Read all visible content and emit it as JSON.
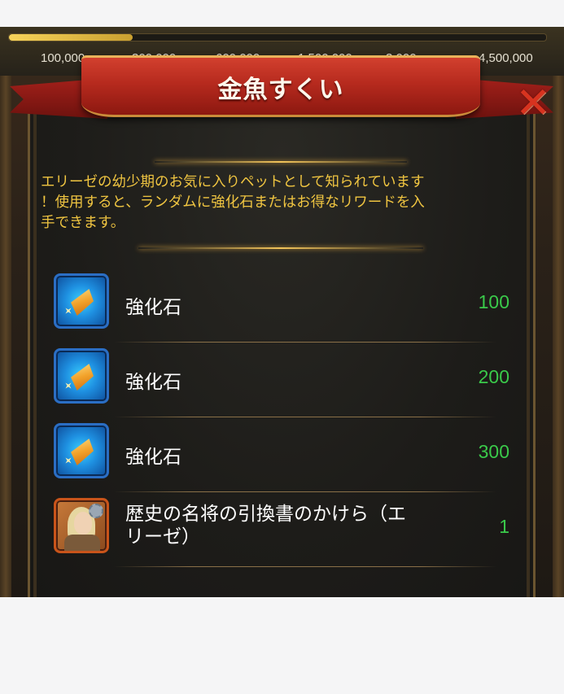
{
  "background": {
    "milestones": [
      "100,000",
      "300,000",
      "600,000",
      "1,500,000",
      "3,000",
      "4,500,000"
    ],
    "progress_fraction": 0.23
  },
  "dialog": {
    "title": "金魚すくい",
    "close_icon": "close-x-icon",
    "description_lines": [
      "エリーゼの幼少期のお気に入りペットとして知られています",
      "！使用すると、ランダムに強化石またはお得なリワードを入",
      "手できます。"
    ],
    "rewards": [
      {
        "icon": "enhancement-stone-icon",
        "name": "強化石",
        "quantity": "100"
      },
      {
        "icon": "enhancement-stone-icon",
        "name": "強化石",
        "quantity": "200"
      },
      {
        "icon": "enhancement-stone-icon",
        "name": "強化石",
        "quantity": "300"
      },
      {
        "icon": "hero-exchange-scroll-icon",
        "name_line1": "歴史の名将の引換書のかけら（エ",
        "name_line2": "リーゼ）",
        "quantity": "1"
      }
    ]
  },
  "colors": {
    "title_ribbon": "#b62a1e",
    "description_text": "#f0c541",
    "quantity_text": "#3ac94a",
    "close_button": "#d8331f"
  }
}
